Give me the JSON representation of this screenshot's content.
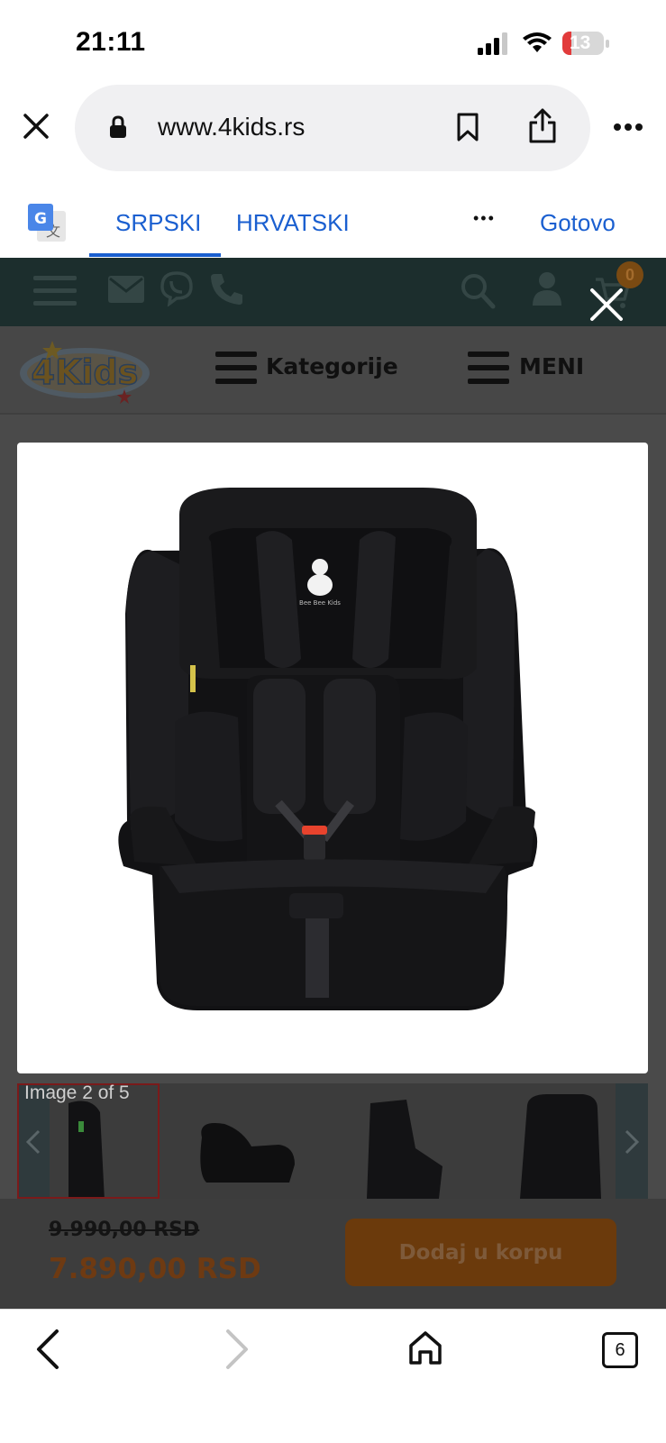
{
  "status_bar": {
    "time": "21:11",
    "battery": "13"
  },
  "browser": {
    "url": "www.4kids.rs",
    "close_icon": "close-icon",
    "tab_count": "6"
  },
  "translate_bar": {
    "languages": [
      "SRPSKI",
      "HRVATSKI"
    ],
    "selected": "SRPSKI",
    "more": "•••",
    "done_label": "Gotovo"
  },
  "site": {
    "cart_count": "0",
    "logo_text": "4Kids",
    "categories_label": "Kategorije",
    "menu_label": "MENI"
  },
  "lightbox": {
    "caption": "Image 2 of 5",
    "seat_badge_text": "Bee Bee Kids"
  },
  "product": {
    "old_price": "9.990,00 RSD",
    "new_price": "7.890,00 RSD",
    "add_to_cart_label": "Dodaj u korpu"
  },
  "colors": {
    "translate_blue": "#1a5fd0",
    "topbar": "#1c2e2d",
    "price_orange": "#6e3a12",
    "cart_badge": "#7a4a12",
    "buckle_red": "#e8432d"
  }
}
